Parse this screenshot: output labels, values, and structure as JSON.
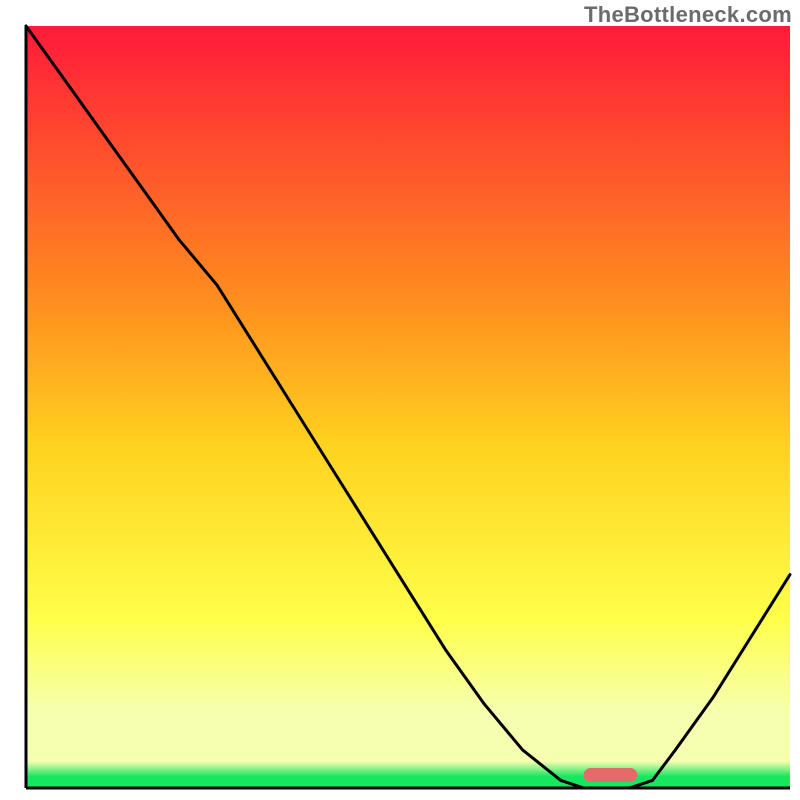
{
  "watermark": "TheBottleneck.com",
  "colors": {
    "axis": "#000000",
    "curve": "#000000",
    "marker_fill": "#e66a6a",
    "grad_top": "#ff1a3a",
    "grad_mid_upper": "#ff8a1f",
    "grad_mid": "#ffd21f",
    "grad_mid_lower": "#ffff4a",
    "grad_pale": "#f6ffb0",
    "grad_green": "#17e65f"
  },
  "chart_data": {
    "type": "line",
    "title": "",
    "xlabel": "",
    "ylabel": "",
    "xlim": [
      0,
      100
    ],
    "ylim": [
      0,
      100
    ],
    "x": [
      0,
      5,
      10,
      15,
      20,
      25,
      30,
      35,
      40,
      45,
      50,
      55,
      60,
      65,
      70,
      73,
      76,
      79,
      82,
      85,
      90,
      95,
      100
    ],
    "values": [
      100,
      93,
      86,
      79,
      72,
      66,
      58,
      50,
      42,
      34,
      26,
      18,
      11,
      5,
      1,
      0,
      0,
      0,
      1,
      5,
      12,
      20,
      28
    ],
    "background_gradient_stops": [
      {
        "offset": 0.0,
        "value": 100
      },
      {
        "offset": 0.35,
        "value": 65
      },
      {
        "offset": 0.55,
        "value": 45
      },
      {
        "offset": 0.78,
        "value": 22
      },
      {
        "offset": 0.9,
        "value": 10
      },
      {
        "offset": 0.97,
        "value": 3
      },
      {
        "offset": 1.0,
        "value": 0
      }
    ],
    "optimal_marker": {
      "x_start": 73,
      "x_end": 80,
      "y": 0
    }
  }
}
